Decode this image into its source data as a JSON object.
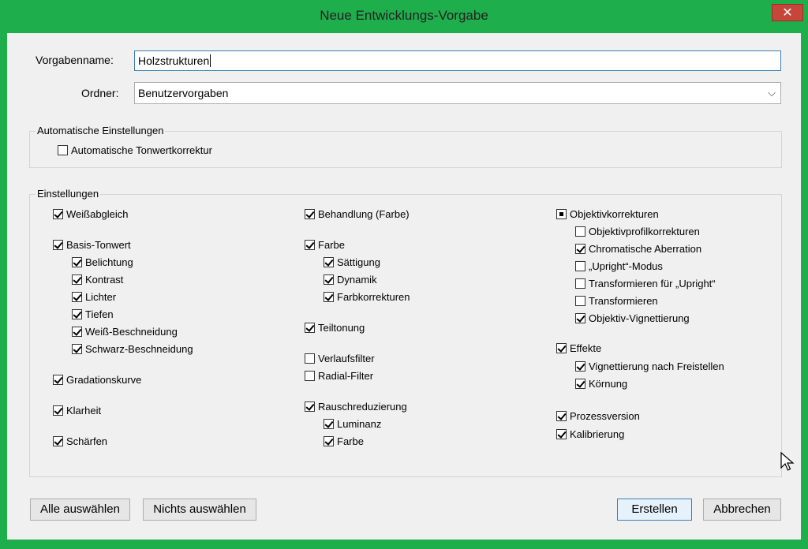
{
  "window": {
    "title": "Neue Entwicklungs-Vorgabe",
    "close_glyph": "✕"
  },
  "form": {
    "name_label": "Vorgabenname:",
    "name_value": "Holzstrukturen",
    "folder_label": "Ordner:",
    "folder_value": "Benutzervorgaben"
  },
  "auto_group": {
    "title": "Automatische Einstellungen",
    "items": [
      {
        "label": "Automatische Tonwertkorrektur",
        "checked": false
      }
    ]
  },
  "settings_group": {
    "title": "Einstellungen",
    "col1": [
      {
        "label": "Weißabgleich",
        "checked": true
      },
      {
        "label": "Basis-Tonwert",
        "checked": true
      },
      {
        "label": "Belichtung",
        "checked": true
      },
      {
        "label": "Kontrast",
        "checked": true
      },
      {
        "label": "Lichter",
        "checked": true
      },
      {
        "label": "Tiefen",
        "checked": true
      },
      {
        "label": "Weiß-Beschneidung",
        "checked": true
      },
      {
        "label": "Schwarz-Beschneidung",
        "checked": true
      },
      {
        "label": "Gradationskurve",
        "checked": true
      },
      {
        "label": "Klarheit",
        "checked": true
      },
      {
        "label": "Schärfen",
        "checked": true
      }
    ],
    "col2": [
      {
        "label": "Behandlung (Farbe)",
        "checked": true
      },
      {
        "label": "Farbe",
        "checked": true
      },
      {
        "label": "Sättigung",
        "checked": true
      },
      {
        "label": "Dynamik",
        "checked": true
      },
      {
        "label": "Farbkorrekturen",
        "checked": true
      },
      {
        "label": "Teiltonung",
        "checked": true
      },
      {
        "label": "Verlaufsfilter",
        "checked": false
      },
      {
        "label": "Radial-Filter",
        "checked": false
      },
      {
        "label": "Rauschreduzierung",
        "checked": true
      },
      {
        "label": "Luminanz",
        "checked": true
      },
      {
        "label": "Farbe",
        "checked": true
      }
    ],
    "col3": [
      {
        "label": "Objektivkorrekturen",
        "state": "mixed"
      },
      {
        "label": "Objektivprofilkorrekturen",
        "checked": false
      },
      {
        "label": "Chromatische Aberration",
        "checked": true
      },
      {
        "label": "„Upright“-Modus",
        "checked": false
      },
      {
        "label": "Transformieren für „Upright“",
        "checked": false
      },
      {
        "label": "Transformieren",
        "checked": false
      },
      {
        "label": "Objektiv-Vignettierung",
        "checked": true
      },
      {
        "label": "Effekte",
        "checked": true
      },
      {
        "label": "Vignettierung nach Freistellen",
        "checked": true
      },
      {
        "label": "Körnung",
        "checked": true
      },
      {
        "label": "Prozessversion",
        "checked": true
      },
      {
        "label": "Kalibrierung",
        "checked": true
      }
    ]
  },
  "buttons": {
    "select_all": "Alle auswählen",
    "select_none": "Nichts auswählen",
    "create": "Erstellen",
    "cancel": "Abbrechen"
  },
  "icons": {
    "dropdown": "chevron-down-icon",
    "close": "close-icon",
    "cursor": "mouse-pointer-icon"
  },
  "colors": {
    "window_frame": "#1fae4c",
    "close_button": "#c7463a",
    "dialog_bg": "#f0f0f0",
    "focus_border": "#3c7fb1"
  }
}
